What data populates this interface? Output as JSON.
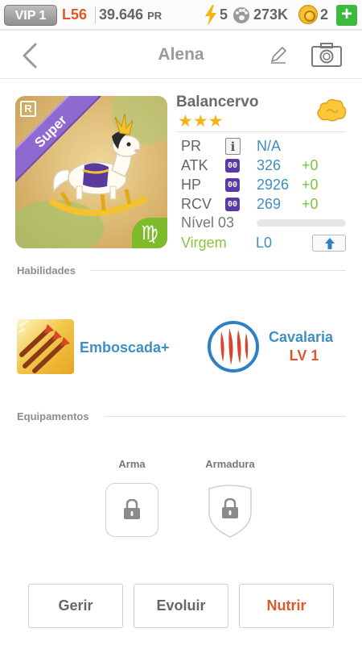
{
  "status_bar": {
    "vip": "VIP 1",
    "level": "L56",
    "power_value": "39.646",
    "power_unit": "PR",
    "energy": "5",
    "paws": "273K",
    "coins": "2",
    "add_label": "+"
  },
  "header": {
    "title": "Alena"
  },
  "card": {
    "rarity_letter": "R",
    "rarity_label": "Super",
    "zodiac_symbol": "♍",
    "name": "Balancervo",
    "stars": "★★★",
    "star_count": 3
  },
  "stats": {
    "pr": {
      "label": "PR",
      "value": "N/A",
      "icon": "info-icon"
    },
    "atk": {
      "label": "ATK",
      "icon_text": "00",
      "value": "326",
      "bonus": "+0"
    },
    "hp": {
      "label": "HP",
      "icon_text": "00",
      "value": "2926",
      "bonus": "+0"
    },
    "rcv": {
      "label": "RCV",
      "icon_text": "00",
      "value": "269",
      "bonus": "+0"
    },
    "level_label": "Nível 03",
    "exp_progress": 0,
    "zodiac_name": "Virgem",
    "lo_label": "L0"
  },
  "skills": {
    "section_title": "Habilidades",
    "items": [
      {
        "name": "Emboscada+",
        "icon": "arrows-icon"
      },
      {
        "name": "Cavalaria",
        "level": "LV 1",
        "icon": "claw-marks-icon"
      }
    ]
  },
  "equipment": {
    "section_title": "Equipamentos",
    "weapon_label": "Arma",
    "armor_label": "Armadura"
  },
  "actions": {
    "manage": "Gerir",
    "evolve": "Evoluir",
    "nurture": "Nutrir"
  },
  "colors": {
    "accent_orange": "#e0572a",
    "value_blue": "#3f8fc4",
    "bonus_green": "#7ec43c",
    "star_gold": "#f4b417",
    "super_purple": "#8e6ad0",
    "add_green": "#3db93d"
  }
}
